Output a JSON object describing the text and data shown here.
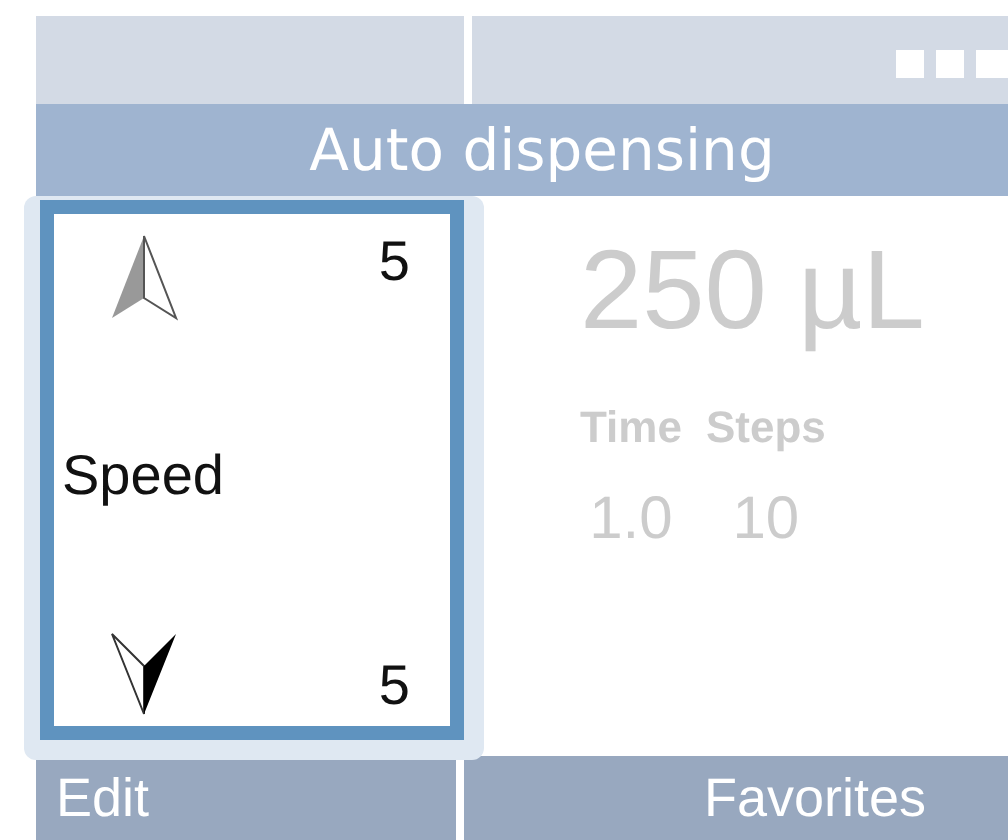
{
  "header": {
    "title": "Auto dispensing"
  },
  "main": {
    "volume": "250 µL",
    "params": [
      {
        "label": "Time",
        "value": "1.0"
      },
      {
        "label": "Steps",
        "value": "10"
      }
    ]
  },
  "speed_popup": {
    "label": "Speed",
    "up_value": "5",
    "down_value": "5"
  },
  "bottom_bar": {
    "buttons": [
      "Edit",
      "Favorites"
    ]
  }
}
